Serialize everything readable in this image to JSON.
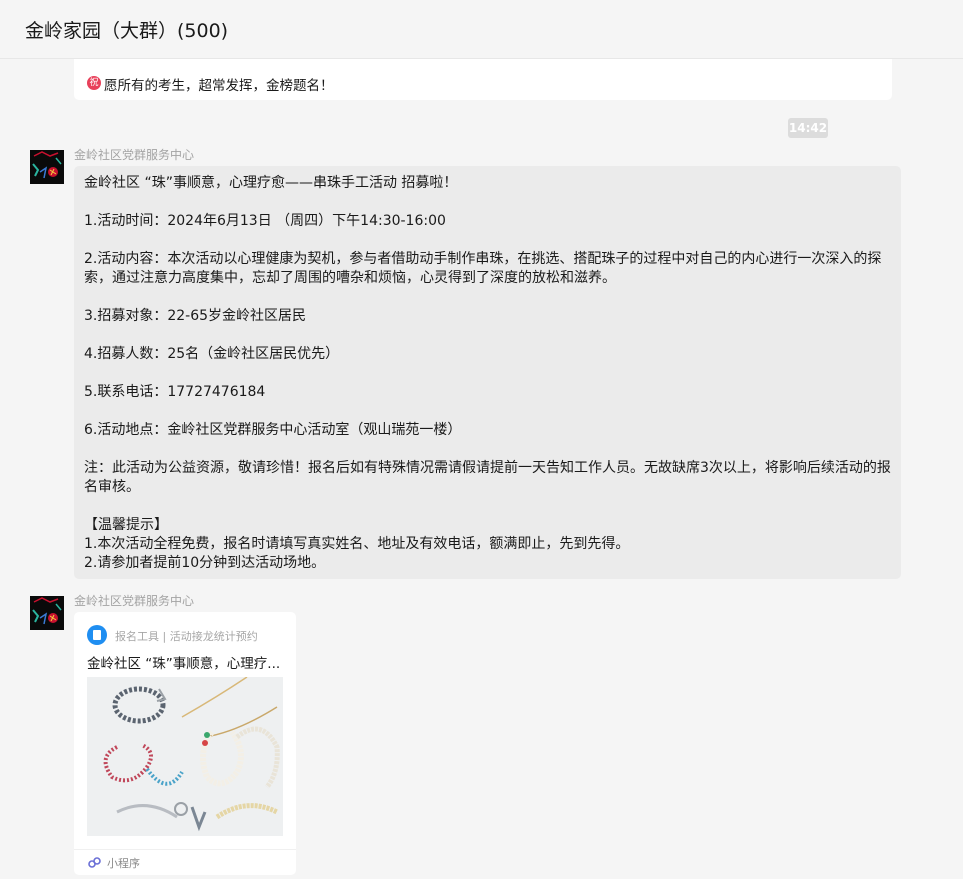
{
  "header": {
    "title": "金岭家园（大群）(500)"
  },
  "messages": {
    "prev": {
      "badge": "祝",
      "text": "愿所有的考生，超常发挥，金榜题名！"
    },
    "time": "14:42",
    "msg1": {
      "sender": "金岭社区党群服务中心",
      "lines": [
        "金岭社区 “珠”事顺意，心理疗愈——串珠手工活动 招募啦！",
        "1.活动时间：2024年6月13日 （周四）下午14:30-16:00",
        "2.活动内容：本次活动以心理健康为契机，参与者借助动手制作串珠，在挑选、搭配珠子的过程中对自己的内心进行一次深入的探索，通过注意力高度集中，忘却了周围的嘈杂和烦恼，心灵得到了深度的放松和滋养。",
        "3.招募对象：22-65岁金岭社区居民",
        "4.招募人数：25名（金岭社区居民优先）",
        "5.联系电话：17727476184",
        "6.活动地点：金岭社区党群服务中心活动室（观山瑞苑一楼）",
        "注：此活动为公益资源，敬请珍惜！报名后如有特殊情况需请假请提前一天告知工作人员。无故缺席3次以上，将影响后续活动的报名审核。",
        "【温馨提示】",
        "1.本次活动全程免费，报名时请填写真实姓名、地址及有效电话，额满即止，先到先得。",
        "2.请参加者提前10分钟到达活动场地。"
      ]
    },
    "msg2": {
      "sender": "金岭社区党群服务中心",
      "card": {
        "source": "报名工具 | 活动接龙统计预约",
        "title": "金岭社区 “珠”事顺意，心理疗...",
        "footer": "小程序"
      }
    }
  },
  "colors": {
    "background": "#f5f5f5",
    "bubble": "#ebebeb",
    "card": "#ffffff",
    "sender": "#a3a3a3",
    "badge": "#e8405a",
    "app_icon": "#1f8ef1"
  },
  "icons": {
    "badge": "zhu-badge-icon",
    "app": "form-tool-icon",
    "mini_program": "mini-program-icon",
    "avatar": "party-service-avatar"
  }
}
